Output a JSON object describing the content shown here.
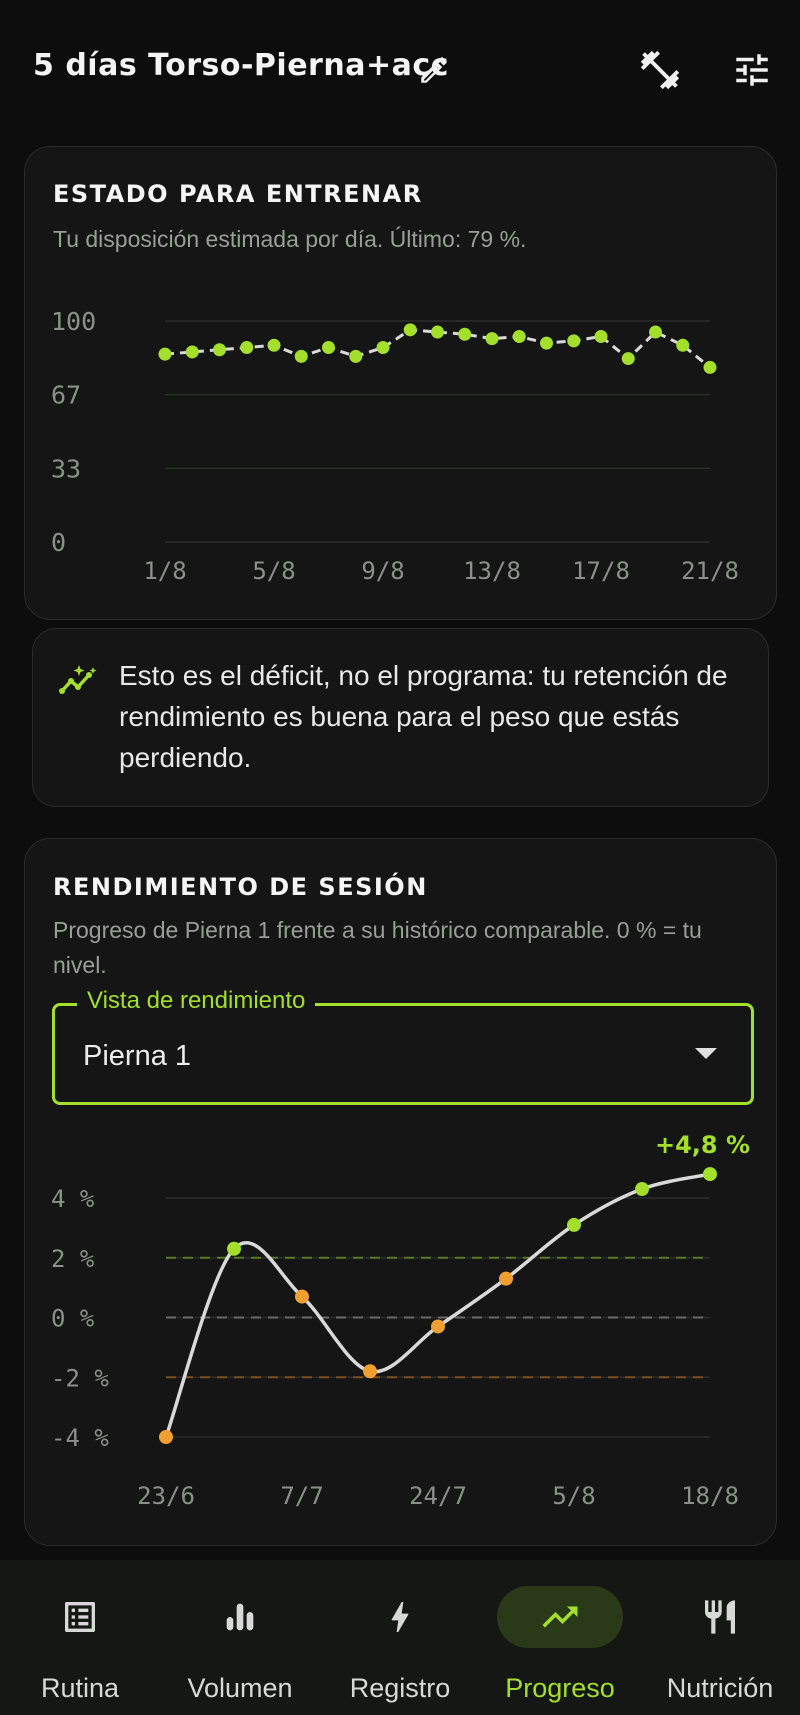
{
  "header": {
    "title": "5 días Torso-Pierna+acc",
    "icons": [
      "edit-icon",
      "dumbbell-icon",
      "tune-icon"
    ]
  },
  "readiness": {
    "title": "ESTADO PARA ENTRENAR",
    "subtitle": "Tu disposición estimada por día. Último: 79 %."
  },
  "insight": {
    "icon": "sparkle-trend-icon",
    "text": "Esto es el déficit, no el programa: tu retención de rendimiento es buena para el peso que estás perdiendo."
  },
  "performance": {
    "title": "RENDIMIENTO DE SESIÓN",
    "subtitle": "Progreso de Pierna 1 frente a su histórico comparable. 0 % = tu nivel.",
    "select_label": "Vista de rendimiento",
    "select_value": "Pierna 1",
    "last_value_label": "+4,8 %"
  },
  "chart_data": [
    {
      "type": "line",
      "x": [
        "1/8",
        "2/8",
        "3/8",
        "4/8",
        "5/8",
        "6/8",
        "7/8",
        "8/8",
        "9/8",
        "10/8",
        "11/8",
        "12/8",
        "13/8",
        "14/8",
        "15/8",
        "16/8",
        "17/8",
        "18/8",
        "19/8",
        "20/8",
        "21/8"
      ],
      "x_tick_labels": [
        "1/8",
        "5/8",
        "9/8",
        "13/8",
        "17/8",
        "21/8"
      ],
      "values": [
        85,
        86,
        87,
        88,
        89,
        84,
        88,
        84,
        88,
        96,
        95,
        94,
        92,
        93,
        90,
        91,
        93,
        83,
        95,
        89,
        79
      ],
      "y_ticks": [
        "100",
        "67",
        "33",
        "0"
      ],
      "ylim": [
        0,
        100
      ],
      "colors": {
        "line": "#d9d9d9",
        "points": "#a3df2b",
        "grid": "#2b2d2b"
      },
      "grid": true
    },
    {
      "type": "line",
      "x": [
        "23/6",
        "30/6",
        "7/7",
        "17/7",
        "24/7",
        "31/7",
        "5/8",
        "12/8",
        "18/8"
      ],
      "x_tick_labels": [
        "23/6",
        "7/7",
        "24/7",
        "5/8",
        "18/8"
      ],
      "values": [
        -4.0,
        2.3,
        0.7,
        -1.8,
        -0.3,
        1.3,
        3.1,
        4.3,
        4.8
      ],
      "point_colors": [
        "#f0a030",
        "#a3df2b",
        "#f0a030",
        "#f0a030",
        "#f0a030",
        "#f0a030",
        "#a3df2b",
        "#a3df2b",
        "#a3df2b"
      ],
      "y_ticks": [
        "4 %",
        "2 %",
        "0 %",
        "-2 %",
        "-4 %"
      ],
      "ylim": [
        -4,
        4
      ],
      "reference_lines": [
        {
          "y": 2,
          "color": "#5a7a2a",
          "style": "dashed"
        },
        {
          "y": 0,
          "color": "#6a6a6a",
          "style": "dashed"
        },
        {
          "y": -2,
          "color": "#7a5020",
          "style": "dashed"
        }
      ],
      "colors": {
        "line": "#d9d9d9",
        "grid": "#2b2d2b"
      },
      "grid": true
    }
  ],
  "nav": {
    "items": [
      {
        "label": "Rutina",
        "icon": "list-icon",
        "active": false
      },
      {
        "label": "Volumen",
        "icon": "bar-chart-icon",
        "active": false
      },
      {
        "label": "Registro",
        "icon": "bolt-icon",
        "active": false
      },
      {
        "label": "Progreso",
        "icon": "trending-up-icon",
        "active": true
      },
      {
        "label": "Nutrición",
        "icon": "restaurant-icon",
        "active": false
      }
    ]
  }
}
